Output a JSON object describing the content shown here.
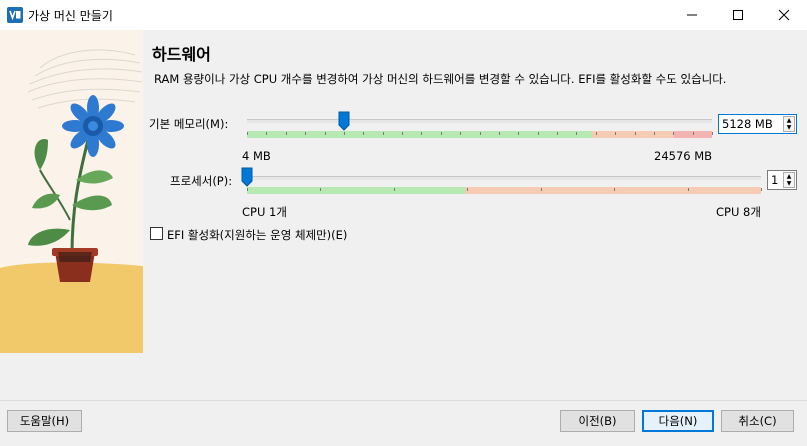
{
  "window": {
    "title": "가상 머신 만들기",
    "app_icon": "virtualbox-icon",
    "controls": [
      "minimize-icon",
      "maximize-icon",
      "close-icon"
    ]
  },
  "page": {
    "heading": "하드웨어",
    "description": "RAM 용량이나 가상 CPU 개수를 변경하여 가상 머신의 하드웨어를 변경할 수 있습니다. EFI를 활성화할 수도 있습니다."
  },
  "memory": {
    "label": "기본 메모리(M):",
    "value": "5128 MB",
    "value_mb": 5128,
    "min_label": "4 MB",
    "max_label": "24576 MB",
    "min": 4,
    "max": 24576
  },
  "processor": {
    "label": "프로세서(P):",
    "value": "1",
    "value_count": 1,
    "min_label": "CPU 1개",
    "max_label": "CPU 8개",
    "min": 1,
    "max": 8
  },
  "efi": {
    "label": "EFI 활성화(지원하는 운영 체제만)(E)",
    "checked": false
  },
  "footer": {
    "help": "도움말(H)",
    "back": "이전(B)",
    "next": "다음(N)",
    "cancel": "취소(C)"
  },
  "colors": {
    "green_range": "#b7eab3",
    "orange_range": "#f6cbb4",
    "red_range": "#f2b3b3",
    "accent": "#0078d7"
  }
}
